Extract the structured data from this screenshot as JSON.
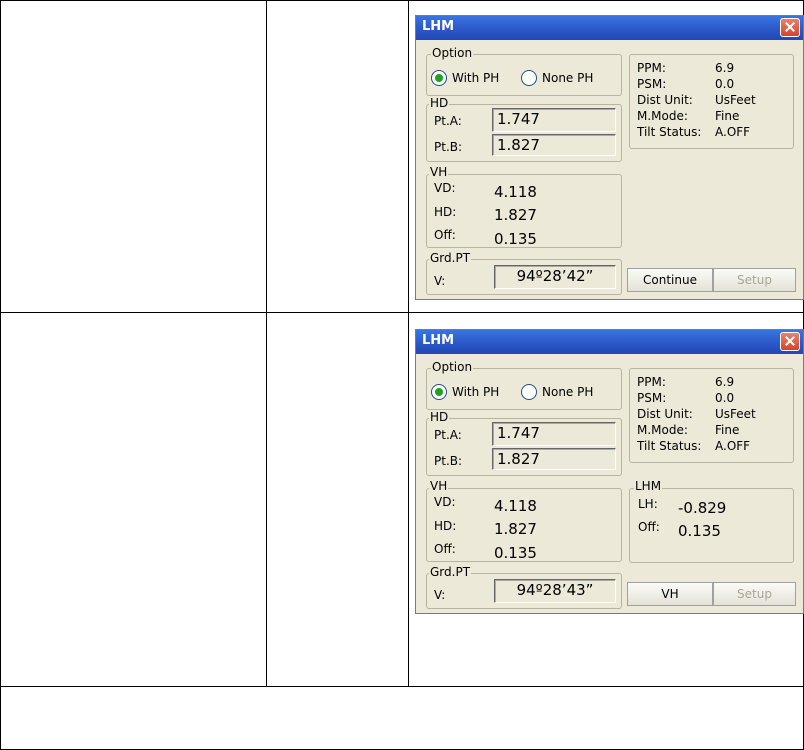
{
  "dialogs": [
    {
      "title": "LHM",
      "option_label": "Option",
      "radio_with": "With PH",
      "radio_none": "None PH",
      "hd_label": "HD",
      "pta_label": "Pt.A:",
      "pta_value": "1.747",
      "ptb_label": "Pt.B:",
      "ptb_value": "1.827",
      "vh_label": "VH",
      "vd_label": "VD:",
      "vd_value": "4.118",
      "hd2_label": "HD:",
      "hd2_value": "1.827",
      "off_label": "Off:",
      "off_value": "0.135",
      "grd_label": "Grd.PT",
      "v_label": "V:",
      "v_value": "94º28’42”",
      "info": {
        "ppm_label": "PPM:",
        "ppm_value": "6.9",
        "psm_label": "PSM:",
        "psm_value": "0.0",
        "dist_label": "Dist Unit:",
        "dist_value": "UsFeet",
        "mmode_label": "M.Mode:",
        "mmode_value": "Fine",
        "tilt_label": "Tilt Status:",
        "tilt_value": "A.OFF"
      },
      "btn_left": "Continue",
      "btn_right": "Setup"
    },
    {
      "title": "LHM",
      "option_label": "Option",
      "radio_with": "With PH",
      "radio_none": "None PH",
      "hd_label": "HD",
      "pta_label": "Pt.A:",
      "pta_value": "1.747",
      "ptb_label": "Pt.B:",
      "ptb_value": "1.827",
      "vh_label": "VH",
      "vd_label": "VD:",
      "vd_value": "4.118",
      "hd2_label": "HD:",
      "hd2_value": "1.827",
      "off_label": "Off:",
      "off_value": "0.135",
      "grd_label": "Grd.PT",
      "v_label": "V:",
      "v_value": "94º28’43”",
      "info": {
        "ppm_label": "PPM:",
        "ppm_value": "6.9",
        "psm_label": "PSM:",
        "psm_value": "0.0",
        "dist_label": "Dist Unit:",
        "dist_value": "UsFeet",
        "mmode_label": "M.Mode:",
        "mmode_value": "Fine",
        "tilt_label": "Tilt Status:",
        "tilt_value": "A.OFF"
      },
      "lhm": {
        "label": "LHM",
        "lh_label": "LH:",
        "lh_value": "-0.829",
        "off_label": "Off:",
        "off_value": "0.135"
      },
      "btn_left": "VH",
      "btn_right": "Setup"
    }
  ],
  "colors": {
    "dialog_bg": "#ece9d8",
    "titlebar": "#2a56c6",
    "radio_checked": "#21a121",
    "close_button": "#d4432a"
  }
}
